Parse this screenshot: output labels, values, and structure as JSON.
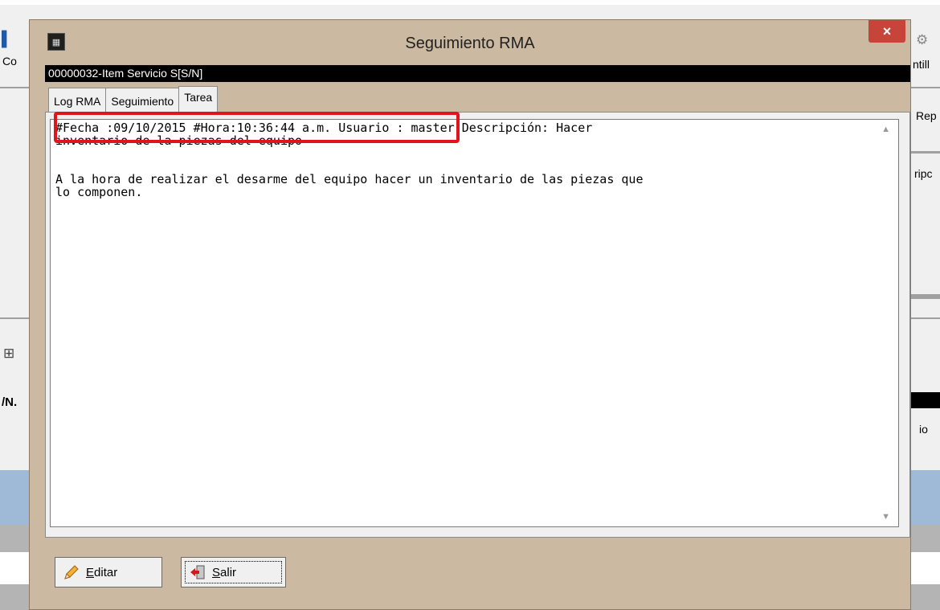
{
  "background": {
    "left_labels": [
      "Co",
      "/N."
    ],
    "right_labels": [
      "ntill",
      "Rep",
      "ripc",
      "io"
    ]
  },
  "dialog": {
    "title": "Seguimiento RMA",
    "close_symbol": "×",
    "item_header": "00000032-Item Servicio S[S/N]",
    "tabs": [
      {
        "label": "Log RMA",
        "active": false
      },
      {
        "label": "Seguimiento",
        "active": false
      },
      {
        "label": "Tarea",
        "active": true
      }
    ],
    "memo_text": "#Fecha :09/10/2015 #Hora:10:36:44 a.m. Usuario : master Descripción: Hacer\ninventario de la piezas del equipo\n\n\nA la hora de realizar el desarme del equipo hacer un inventario de las piezas que\nlo componen.",
    "buttons": {
      "edit_label": "Editar",
      "exit_label": "Salir"
    },
    "highlight_color": "#e0141e"
  }
}
